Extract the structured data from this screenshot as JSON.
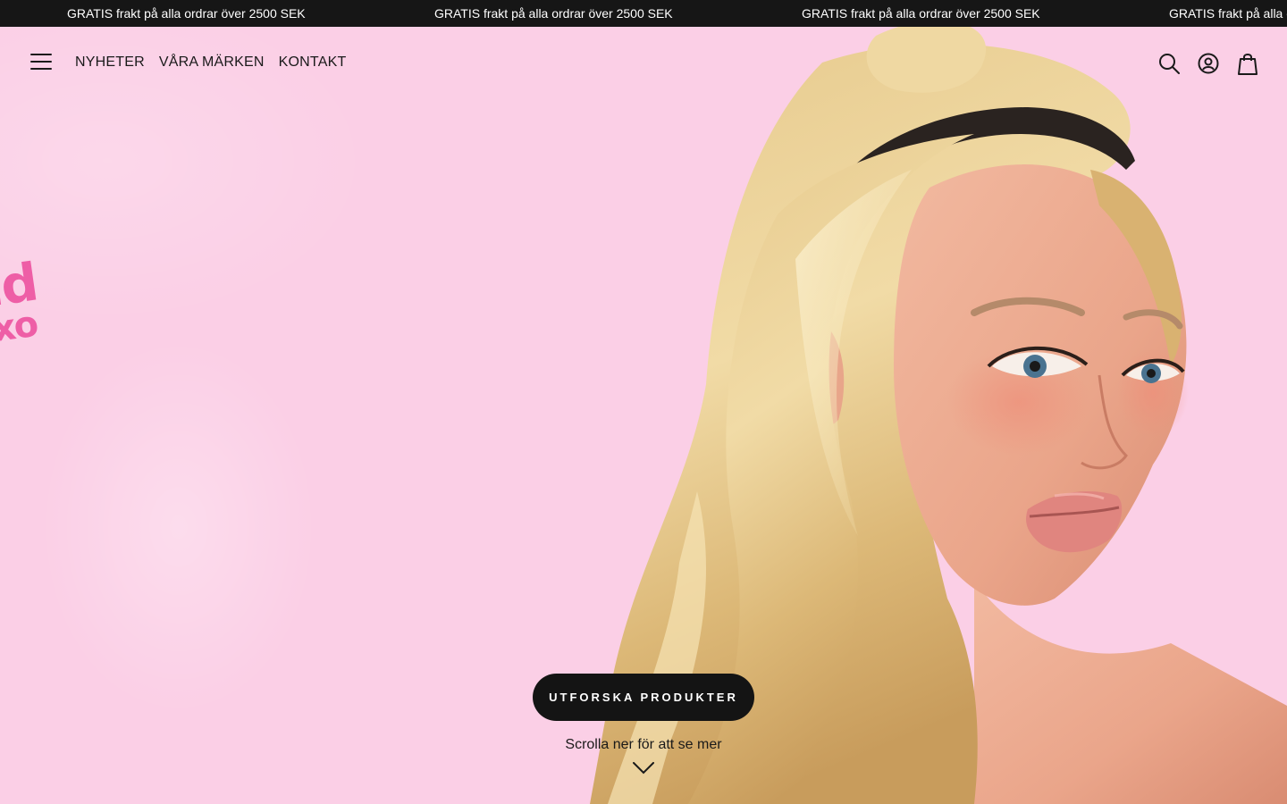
{
  "announcement": {
    "messages": [
      "GRATIS frakt på alla ordrar över 2500 SEK",
      "GRATIS frakt på alla ordrar över 2500 SEK",
      "GRATIS frakt på alla ordrar över 2500 SEK",
      "GRATIS frakt på alla o"
    ]
  },
  "header": {
    "menu_icon": "hamburger-menu-icon",
    "nav": [
      "NYHETER",
      "VÅRA MÄRKEN",
      "KONTAKT"
    ],
    "icons": [
      "search-icon",
      "account-icon",
      "cart-icon"
    ]
  },
  "hero": {
    "scribble_line1": "ld",
    "scribble_line2": "xo",
    "cta_label": "UTFORSKA PRODUKTER",
    "scroll_hint": "Scrolla ner för att se mer",
    "scroll_icon": "chevron-down-icon"
  },
  "colors": {
    "announcement_bg": "#161616",
    "hero_bg": "#fbcfe6",
    "cta_bg": "#141414",
    "scribble": "#ee5ea6"
  }
}
